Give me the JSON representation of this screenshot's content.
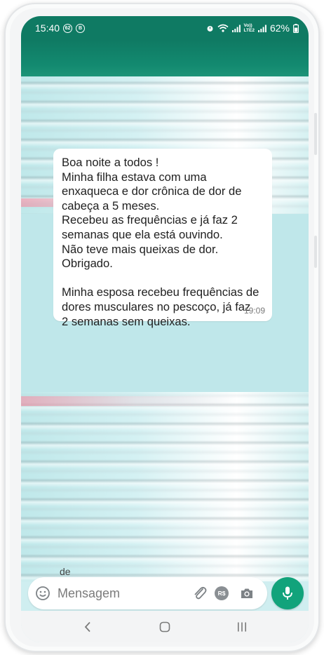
{
  "status_bar": {
    "time": "15:40",
    "badge_1": "62",
    "badge_2": "B",
    "network_label": "Vo))\nLTE2",
    "battery": "62%"
  },
  "message": {
    "lines": [
      "Boa noite a todos !",
      "Minha filha estava com uma",
      "enxaqueca e dor crônica de dor de",
      "cabeça a 5 meses.",
      "Recebeu as frequências e já faz 2",
      "semanas que ela está ouvindo.",
      "Não teve mais queixas de dor.",
      "Obrigado.",
      "",
      "Minha esposa recebeu frequências de",
      "dores musculares no pescoço, já faz",
      "2 semanas sem queixas."
    ],
    "time": "19:09"
  },
  "partial_text": "de",
  "composer": {
    "placeholder": "Mensagem",
    "pay_label": "R$"
  },
  "icons": {
    "emoji": "emoji-icon",
    "attach": "paperclip-icon",
    "camera": "camera-icon",
    "mic": "microphone-icon"
  },
  "colors": {
    "header": "#0f7a63",
    "accent": "#12a37b",
    "chat_background": "#bfe7ea",
    "bubble": "#ffffff"
  }
}
